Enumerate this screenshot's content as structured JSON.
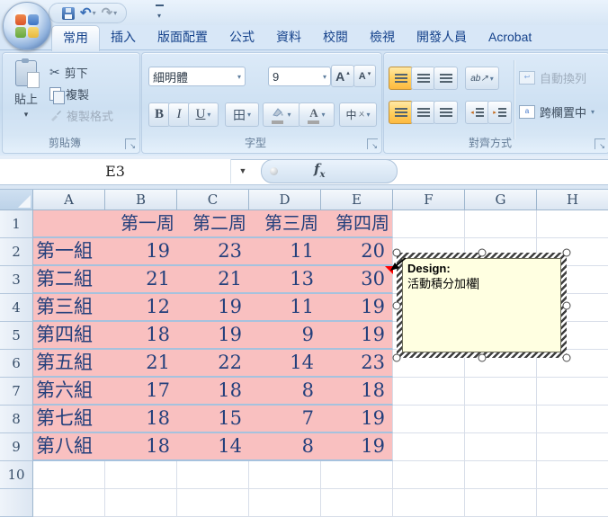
{
  "glyphs": {
    "caret_down": "▾",
    "name_box_caret": "▼",
    "undo": "↶",
    "redo": "↷",
    "scissors": "✂",
    "border_grid": "田",
    "phonetic": "中",
    "phonetic_marks": "ㄨ",
    "orientation": "ab↗",
    "launcher_arrow": "↘",
    "indent_left": "◂",
    "indent_right": "▸",
    "merge_letter": "a"
  },
  "tabs": [
    {
      "id": "home",
      "label": "常用",
      "active": true
    },
    {
      "id": "insert",
      "label": "插入",
      "active": false
    },
    {
      "id": "page-layout",
      "label": "版面配置",
      "active": false
    },
    {
      "id": "formulas",
      "label": "公式",
      "active": false
    },
    {
      "id": "data",
      "label": "資料",
      "active": false
    },
    {
      "id": "review",
      "label": "校閱",
      "active": false
    },
    {
      "id": "view",
      "label": "檢視",
      "active": false
    },
    {
      "id": "developer",
      "label": "開發人員",
      "active": false
    },
    {
      "id": "acrobat",
      "label": "Acrobat",
      "active": false
    }
  ],
  "ribbon": {
    "clipboard": {
      "label": "剪貼簿",
      "paste_label": "貼上",
      "cut_label": "剪下",
      "copy_label": "複製",
      "format_painter_label": "複製格式"
    },
    "font": {
      "label": "字型",
      "font_name": "細明體",
      "font_size": "9",
      "bold": "B",
      "italic": "I",
      "underline": "U",
      "grow_font": "A",
      "shrink_font": "A",
      "font_color_letter": "A"
    },
    "alignment": {
      "label": "對齊方式",
      "wrap_text_label": "自動換列",
      "merge_center_label": "跨欄置中"
    }
  },
  "formula_bar": {
    "cell_reference": "E3",
    "fx_label": "f",
    "fx_sub": "x",
    "formula_value": ""
  },
  "sheet": {
    "columns": [
      "A",
      "B",
      "C",
      "D",
      "E",
      "F",
      "G",
      "H"
    ],
    "row_numbers": [
      "1",
      "2",
      "3",
      "4",
      "5",
      "6",
      "7",
      "8",
      "9",
      "10"
    ],
    "table": {
      "week_headers": [
        "第一周",
        "第二周",
        "第三周",
        "第四周"
      ],
      "rows": [
        {
          "group": "第一組",
          "values": [
            19,
            23,
            11,
            20
          ]
        },
        {
          "group": "第二組",
          "values": [
            21,
            21,
            13,
            30
          ]
        },
        {
          "group": "第三組",
          "values": [
            12,
            19,
            11,
            19
          ]
        },
        {
          "group": "第四組",
          "values": [
            18,
            19,
            9,
            19
          ]
        },
        {
          "group": "第五組",
          "values": [
            21,
            22,
            14,
            23
          ]
        },
        {
          "group": "第六組",
          "values": [
            17,
            18,
            8,
            18
          ]
        },
        {
          "group": "第七組",
          "values": [
            18,
            15,
            7,
            19
          ]
        },
        {
          "group": "第八組",
          "values": [
            18,
            14,
            8,
            19
          ]
        }
      ]
    }
  },
  "comment": {
    "title": "Design:",
    "body": "活動積分加權"
  },
  "colors": {
    "table_fill": "#F9C0C0",
    "table_text": "#24407C",
    "row_separator": "#A6C2DE",
    "selected_button_orange": "#FDB940",
    "comment_fill": "#FFFFE1",
    "comment_indicator": "#FF0000",
    "tab_text": "#15428B"
  }
}
